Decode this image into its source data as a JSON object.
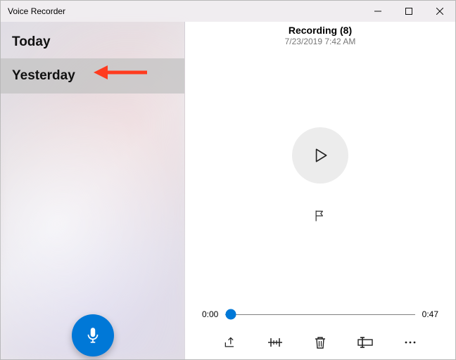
{
  "window": {
    "title": "Voice Recorder"
  },
  "sidebar": {
    "sections": [
      {
        "label": "Today",
        "selected": false
      },
      {
        "label": "Yesterday",
        "selected": true
      }
    ]
  },
  "recording": {
    "title": "Recording (8)",
    "timestamp": "7/23/2019 7:42 AM",
    "current_time": "0:00",
    "total_time": "0:47",
    "progress_percent": 3
  },
  "toolbar": {
    "share": "Share",
    "trim": "Trim",
    "delete": "Delete",
    "rename": "Rename",
    "more": "More"
  },
  "icons": {
    "record": "microphone-icon",
    "play": "play-icon",
    "flag": "flag-icon"
  },
  "colors": {
    "accent": "#0078d7"
  }
}
